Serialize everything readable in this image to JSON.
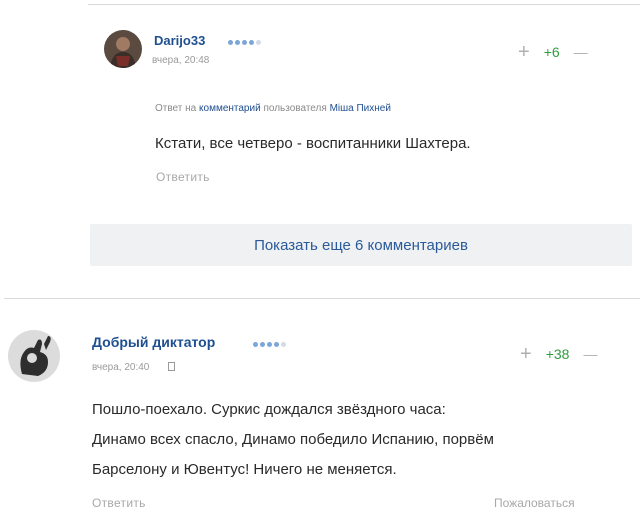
{
  "comments": [
    {
      "username": "Darijo33",
      "rating_dots": 4,
      "timestamp": "вчера, 20:48",
      "vote_plus": "+",
      "score": "+6",
      "vote_minus": "—",
      "reply_prefix": "Ответ на",
      "reply_link": "комментарий",
      "reply_mid": "пользователя",
      "reply_user": "Міша Пихней",
      "text": "Кстати, все четверо - воспитанники Шахтера.",
      "reply_label": "Ответить"
    },
    {
      "username": "Добрый диктатор",
      "rating_dots": 4,
      "timestamp": "вчера, 20:40",
      "vote_plus": "+",
      "score": "+38",
      "vote_minus": "—",
      "text_lines": [
        "Пошло-поехало. Суркис дождался звёздного часа:",
        "Динамо всех спасло, Динамо победило Испанию, порвём",
        "Барселону и Ювентус! Ничего не меняется."
      ],
      "reply_label": "Ответить",
      "report_label": "Пожаловаться"
    }
  ],
  "show_more_label": "Показать еще 6 комментариев",
  "colors": {
    "username": "#1f4f8f",
    "score_positive": "#2e9e3e",
    "muted": "#a8a8a8",
    "show_more_bg": "#f0f1f3"
  }
}
